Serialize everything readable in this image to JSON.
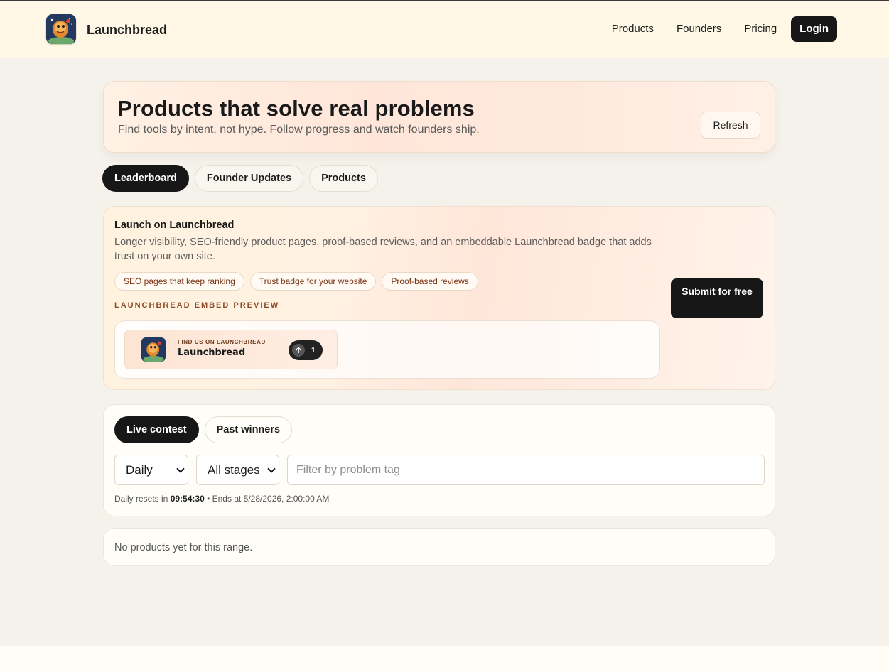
{
  "header": {
    "brand": "Launchbread",
    "nav": [
      "Products",
      "Founders",
      "Pricing"
    ],
    "login_label": "Login"
  },
  "hero": {
    "title": "Products that solve real problems",
    "subtitle": "Find tools by intent, not hype. Follow progress and watch founders ship.",
    "refresh_label": "Refresh"
  },
  "tabs": [
    {
      "label": "Leaderboard",
      "active": true
    },
    {
      "label": "Founder Updates",
      "active": false
    },
    {
      "label": "Products",
      "active": false
    }
  ],
  "launch": {
    "title": "Launch on Launchbread",
    "description": "Longer visibility, SEO-friendly product pages, proof-based reviews, and an embeddable Launchbread badge that adds trust on your own site.",
    "pills": [
      "SEO pages that keep ranking",
      "Trust badge for your website",
      "Proof-based reviews"
    ],
    "embed_label": "LAUNCHBREAD EMBED PREVIEW",
    "badge": {
      "small_text": "FIND US ON LAUNCHBREAD",
      "name": "Launchbread",
      "upvotes": "1",
      "icon": "arrow-up-icon"
    },
    "submit_label": "Submit for free"
  },
  "contest": {
    "tabs": [
      {
        "label": "Live contest",
        "active": true
      },
      {
        "label": "Past winners",
        "active": false
      }
    ],
    "range_select": "Daily",
    "stage_select": "All stages",
    "filter_placeholder": "Filter by problem tag",
    "timer_prefix": "Daily resets in",
    "timer_value": "09:54:30",
    "timer_suffix": "• Ends at 5/28/2026, 2:00:00 AM"
  },
  "empty": {
    "message": "No products yet for this range."
  },
  "colors": {
    "dark": "#171717",
    "accent_brown": "#8a4a24",
    "page_bg": "#f5f2eb",
    "header_bg": "#fff8e6"
  }
}
